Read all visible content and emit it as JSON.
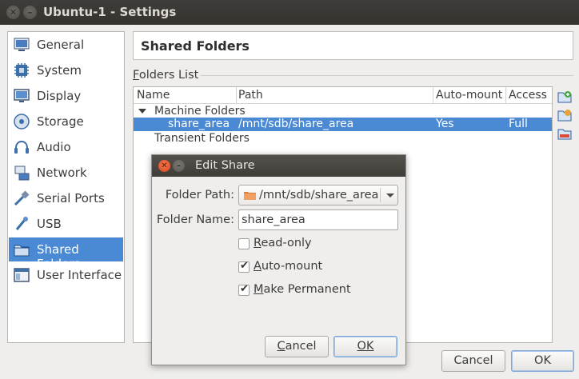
{
  "window": {
    "title": "Ubuntu-1 - Settings"
  },
  "sidebar": {
    "items": [
      {
        "label": "General",
        "icon": "general-icon"
      },
      {
        "label": "System",
        "icon": "system-icon"
      },
      {
        "label": "Display",
        "icon": "display-icon"
      },
      {
        "label": "Storage",
        "icon": "storage-icon"
      },
      {
        "label": "Audio",
        "icon": "audio-icon"
      },
      {
        "label": "Network",
        "icon": "network-icon"
      },
      {
        "label": "Serial Ports",
        "icon": "serial-ports-icon"
      },
      {
        "label": "USB",
        "icon": "usb-icon"
      },
      {
        "label": "Shared Folders",
        "icon": "shared-folders-icon",
        "selected": true
      },
      {
        "label": "User Interface",
        "icon": "user-interface-icon"
      }
    ]
  },
  "page": {
    "title": "Shared Folders",
    "folders_list_label": "Folders List"
  },
  "table": {
    "columns": [
      "Name",
      "Path",
      "Auto-mount",
      "Access"
    ],
    "groups": [
      {
        "label": "Machine Folders",
        "expanded": true,
        "rows": [
          {
            "name": "share_area",
            "path": "/mnt/sdb/share_area",
            "automount": "Yes",
            "access": "Full",
            "selected": true
          }
        ]
      },
      {
        "label": "Transient Folders",
        "expanded": false,
        "rows": []
      }
    ]
  },
  "toolbar": {
    "icons": [
      "add-folder-icon",
      "edit-folder-icon",
      "remove-folder-icon"
    ]
  },
  "buttons": {
    "cancel": "Cancel",
    "ok": "OK"
  },
  "dialog": {
    "title": "Edit Share",
    "folder_path_label": "Folder Path:",
    "folder_path_value": "/mnt/sdb/share_area",
    "folder_name_label": "Folder Name:",
    "folder_name_value": "share_area",
    "read_only": {
      "label": "Read-only",
      "checked": false
    },
    "auto_mount": {
      "label": "Auto-mount",
      "checked": true
    },
    "make_permanent": {
      "label": "Make Permanent",
      "checked": true
    },
    "cancel": "Cancel",
    "ok": "OK"
  },
  "colors": {
    "selection": "#4a8ad4",
    "titlebar": "#3f3d3a",
    "close_button": "#e95420"
  }
}
